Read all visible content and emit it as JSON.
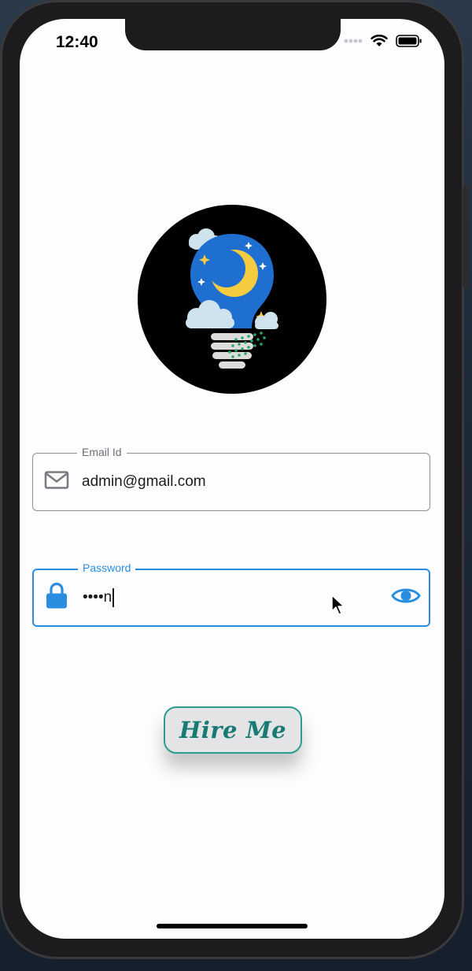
{
  "status_bar": {
    "time": "12:40"
  },
  "email_field": {
    "label": "Email Id",
    "value": "admin@gmail.com"
  },
  "password_field": {
    "label": "Password",
    "masked_value": "••••n"
  },
  "hire_button": {
    "label": "Hire Me"
  },
  "colors": {
    "accent": "#2a8ee0",
    "button_border": "#2a9d8f",
    "button_text": "#177a73",
    "logo_background": "#000000",
    "bulb_blue": "#1f6fd1",
    "moon_yellow": "#f5cb3f"
  },
  "icons": {
    "email": "envelope-icon",
    "password": "lock-icon",
    "visibility": "eye-icon"
  }
}
